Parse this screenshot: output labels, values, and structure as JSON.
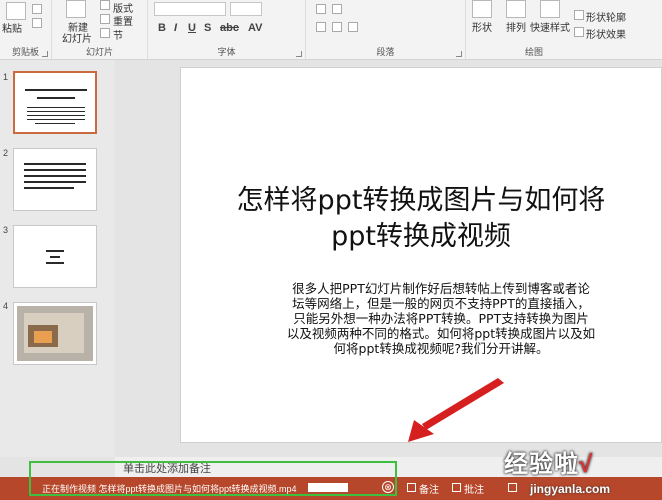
{
  "ribbon": {
    "groups": {
      "clipboard": "剪贴板",
      "slides": "幻灯片",
      "font": "字体",
      "paragraph": "段落",
      "drawing": "绘图"
    },
    "paste": "粘贴",
    "new_slide_1": "新建",
    "new_slide_2": "幻灯片",
    "layout": "版式",
    "reset": "重置",
    "section": "节",
    "shape": "形状",
    "arrange": "排列",
    "quick_styles": "快速样式",
    "shape_outline": "形状轮廓",
    "shape_effects": "形状效果"
  },
  "thumbnails": [
    "1",
    "2",
    "3",
    "4"
  ],
  "slide": {
    "title_lines": [
      "怎样将ppt转换成图片与如何将",
      "ppt转换成视频"
    ],
    "body_lines": [
      "很多人把PPT幻灯片制作好后想转帖上传到博客或者论",
      "坛等网络上，但是一般的网页不支持PPT的直接插入，",
      "只能另外想一种办法将PPT转换。PPT支持转换为图片",
      "以及视频两种不同的格式。如何将ppt转换成图片以及如",
      "何将ppt转换成视频呢?我们分开讲解。"
    ]
  },
  "notes": {
    "placeholder": "单击此处添加备注"
  },
  "status_bar": {
    "progress_text": "正在制作视频 怎样将ppt转换成图片与如何将ppt转换成视频.mp4",
    "progress": 1.0,
    "cancel": "⊗",
    "notes": "备注",
    "comments": "批注"
  },
  "watermark": {
    "main": "经验啦",
    "check": "√",
    "sub": "jingyanla.com"
  },
  "colors": {
    "status_bar": "#b6472a",
    "highlight_box": "#3fbf3f",
    "arrow": "#d62020",
    "selected_thumb": "#c96a3f"
  }
}
